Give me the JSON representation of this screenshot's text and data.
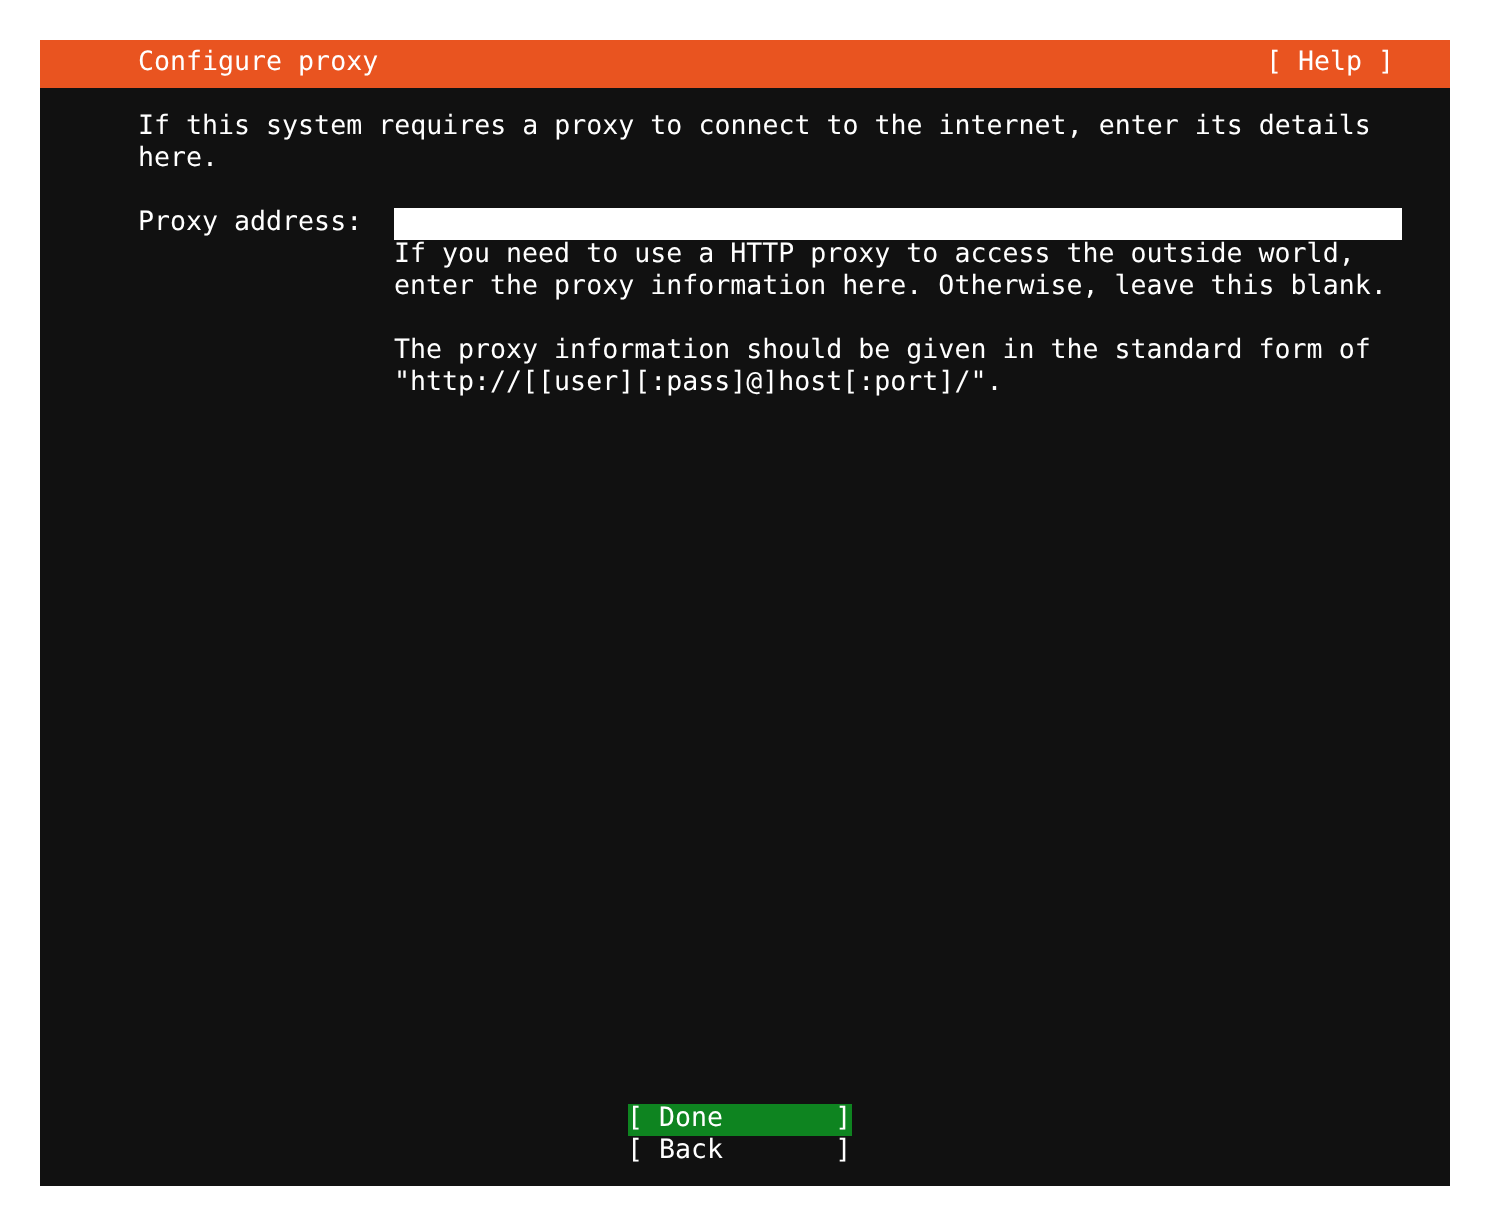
{
  "header": {
    "title": "Configure proxy",
    "help": "[ Help ]"
  },
  "intro": "If this system requires a proxy to connect to the internet, enter its details here.",
  "proxy_field": {
    "label": "Proxy address:",
    "help_paragraphs": [
      "If you need to use a HTTP proxy to access the outside world, enter the proxy information here. Otherwise, leave this blank.",
      "The proxy information should be given in the standard form of \"http://[[user][:pass]@]host[:port]/\"."
    ]
  },
  "buttons": [
    {
      "label": "[ Done       ]",
      "selected": true
    },
    {
      "label": "[ Back       ]",
      "selected": false
    }
  ]
}
